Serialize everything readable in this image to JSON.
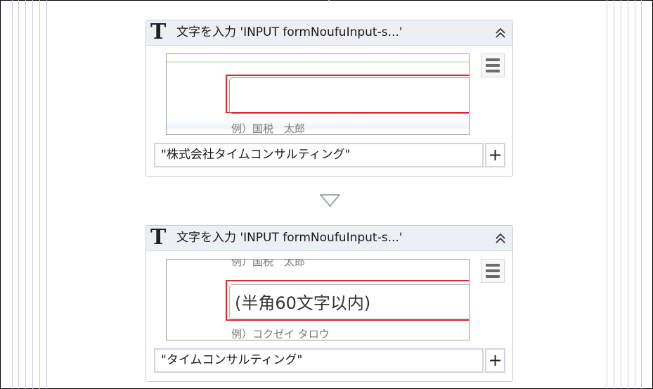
{
  "steps": [
    {
      "title": "文字を入力 'INPUT  formNoufuInput-s...'",
      "value": "\"株式会社タイムコンサルティング\"",
      "preview_partial_text": "例）国税　太郎"
    },
    {
      "title": "文字を入力 'INPUT  formNoufuInput-s...'",
      "value": "\"タイムコンサルティング\"",
      "preview_placeholder": "(半角60文字以内)",
      "preview_partial_text_top": "例）国税　太郎",
      "preview_partial_text_bottom": "例）コクゼイ タロウ"
    }
  ],
  "icons": {
    "type_text": "text-type-icon",
    "collapse": "double-chevron-up-icon",
    "menu": "hamburger-menu-icon",
    "add": "plus-icon",
    "flow_arrow": "down-triangle-icon"
  },
  "add_label": "+",
  "type_icon_glyph": "T"
}
